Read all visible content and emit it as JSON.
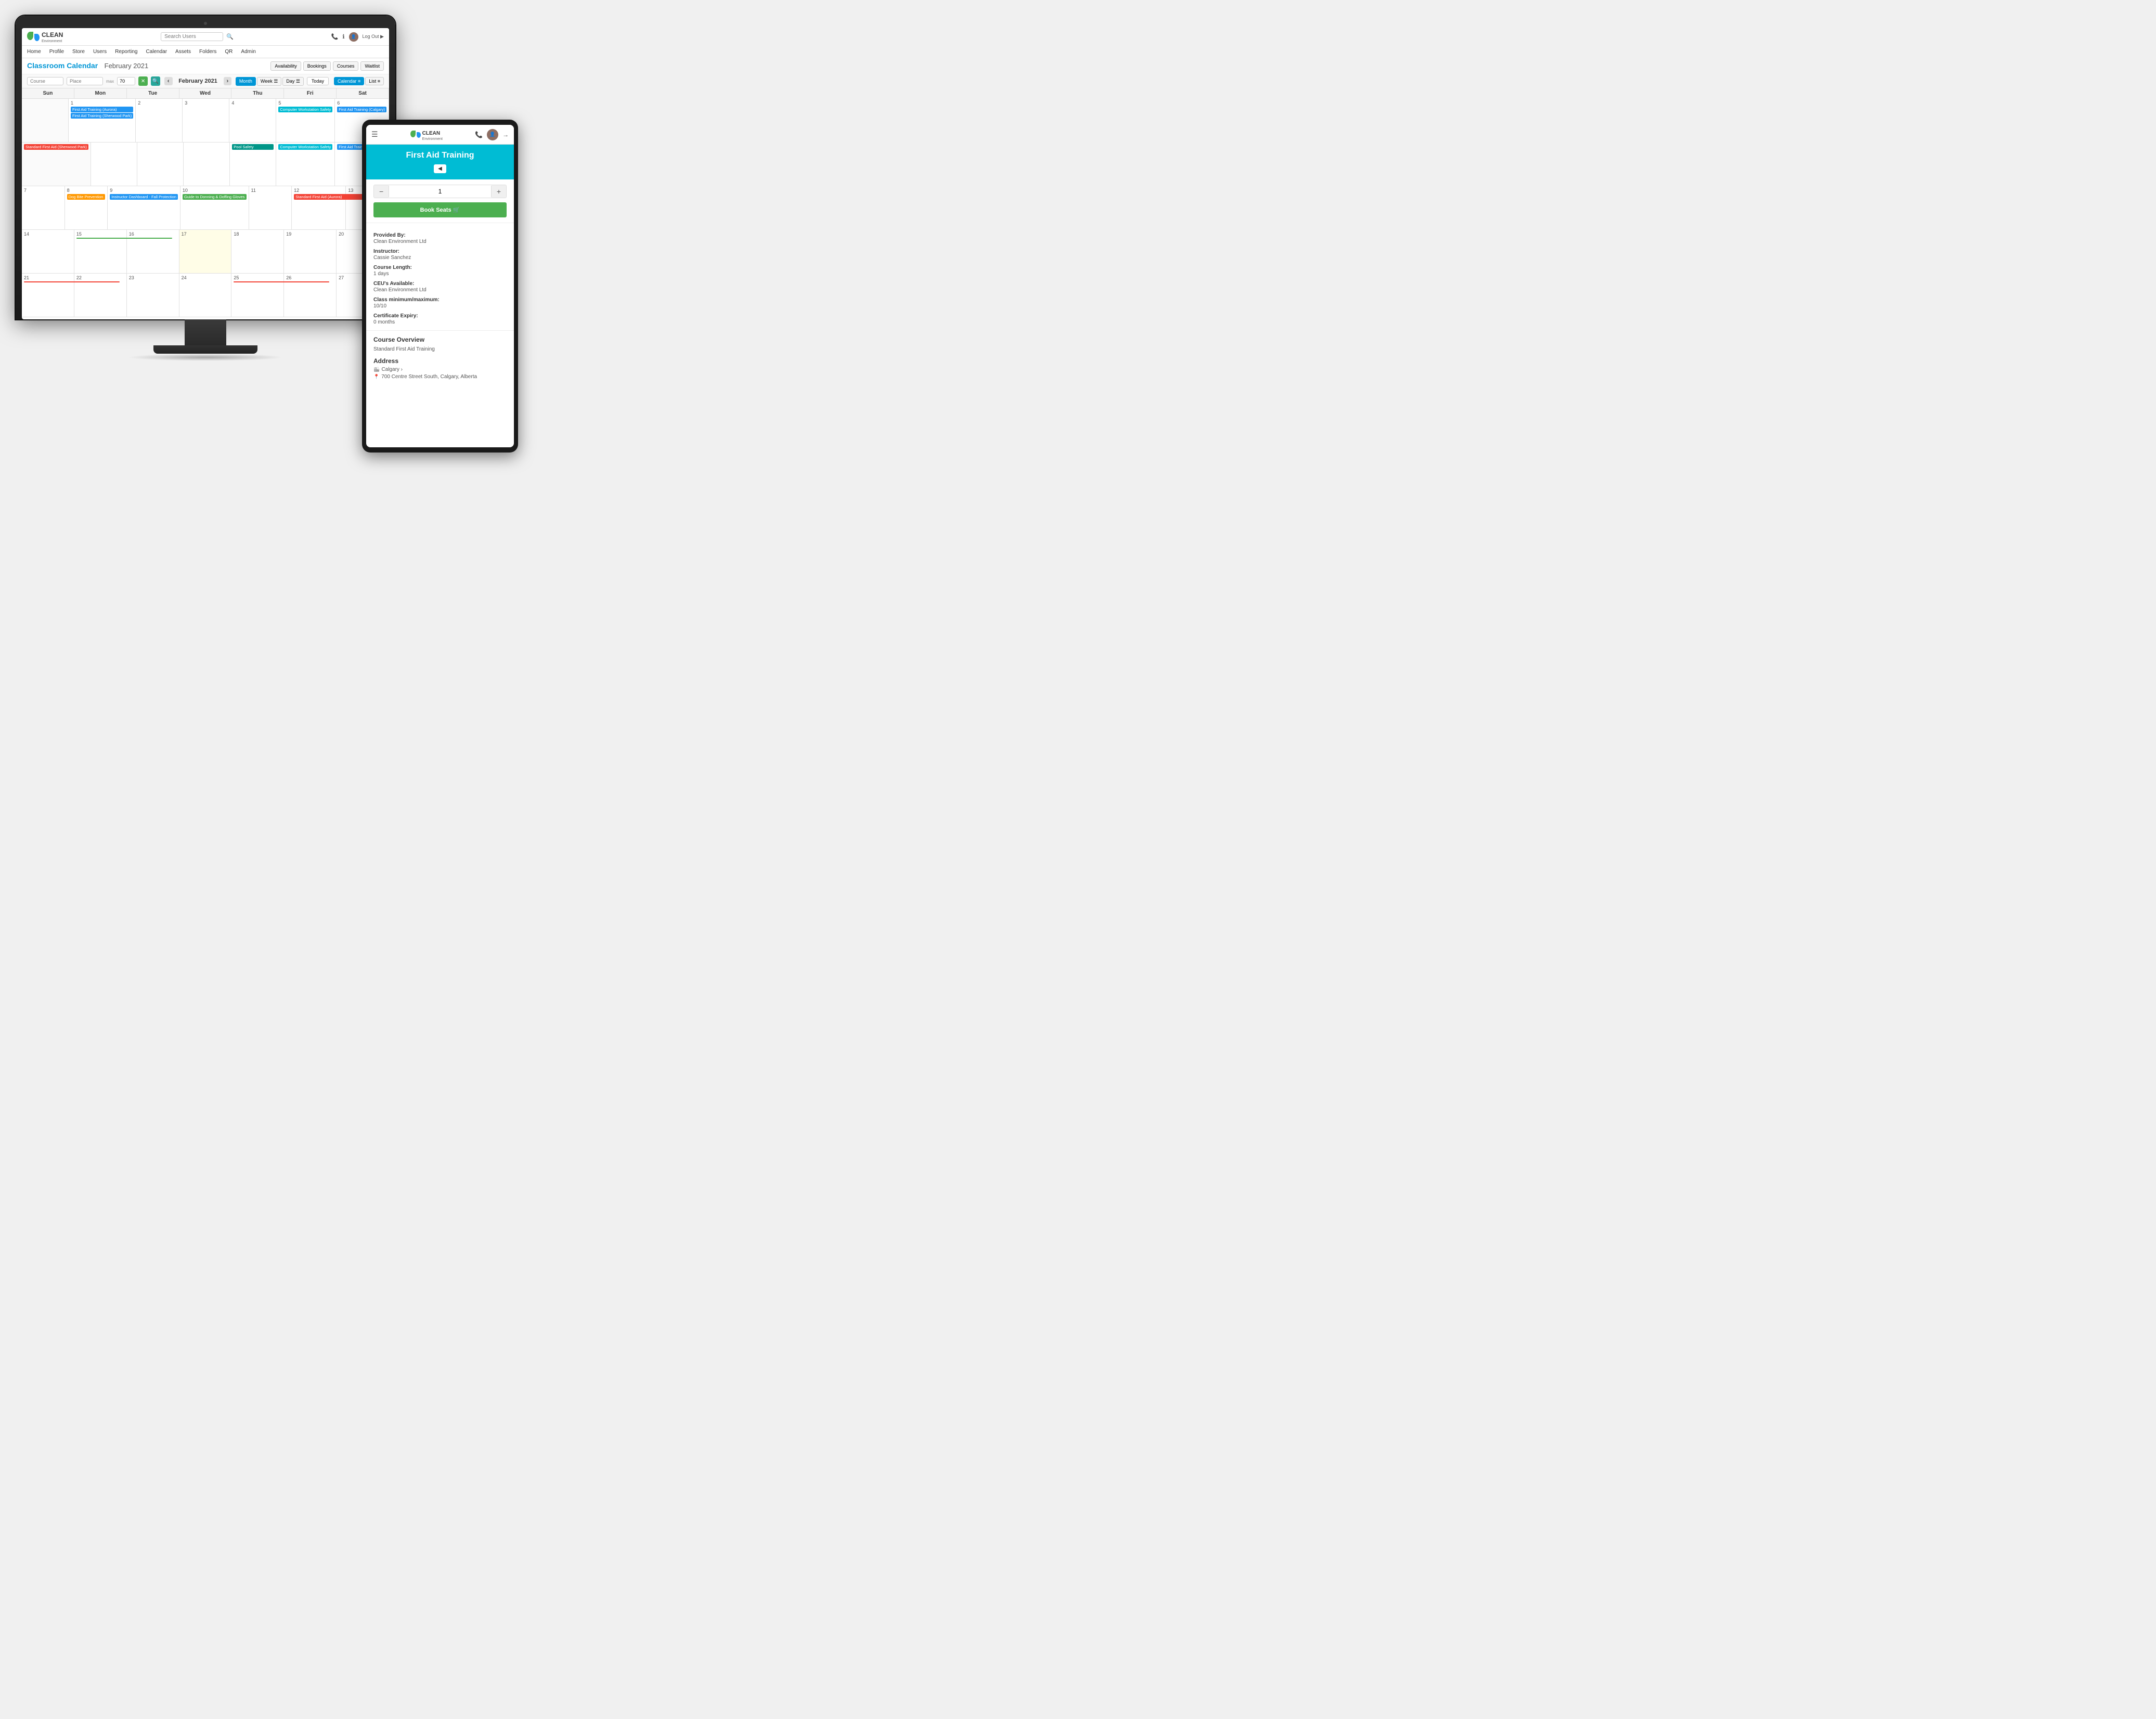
{
  "app": {
    "logo_name": "CLEAN",
    "logo_sub": "Environment",
    "search_placeholder": "Search Users"
  },
  "nav": {
    "items": [
      "Home",
      "Profile",
      "Store",
      "Users",
      "Reporting",
      "Calendar",
      "Assets",
      "Folders",
      "QR",
      "Admin"
    ]
  },
  "calendar": {
    "page_title": "Classroom Calendar",
    "month_label": "February 2021",
    "nav_month": "February 2021",
    "max_label": "max",
    "max_value": "70",
    "course_placeholder": "Course",
    "place_placeholder": "Place",
    "today_label": "Today",
    "calendar_btn": "Calendar ≡",
    "list_btn": "List ≡",
    "month_btn": "Month",
    "week_btn": "Week ☰",
    "day_btn": "Day ☰",
    "availability_btn": "Availability",
    "bookings_btn": "Bookings",
    "courses_btn": "Courses",
    "waitlist_btn": "Waitlist",
    "days": [
      "Sun",
      "Mon",
      "Tue",
      "Wed",
      "Thu",
      "Fri",
      "Sat"
    ],
    "weeks": [
      {
        "cells": [
          {
            "date": "",
            "other": true,
            "events": []
          },
          {
            "date": "1",
            "events": [
              {
                "label": "First Aid Training (Aurora)",
                "color": "ev-blue"
              },
              {
                "label": "First Aid Training (Sherwood Park)",
                "color": "ev-blue"
              }
            ]
          },
          {
            "date": "2",
            "events": []
          },
          {
            "date": "3",
            "events": []
          },
          {
            "date": "4",
            "events": []
          },
          {
            "date": "5",
            "events": [
              {
                "label": "Computer Workstation Safety",
                "color": "ev-cyan"
              }
            ]
          },
          {
            "date": "6",
            "events": [
              {
                "label": "First Aid Training (Calgary)",
                "color": "ev-blue"
              }
            ]
          }
        ]
      },
      {
        "cells": [
          {
            "date": "",
            "other": true,
            "events": [
              {
                "label": "Standard First Aid (Sherwood Park)",
                "color": "ev-red"
              }
            ]
          },
          {
            "date": "",
            "other": false,
            "events": []
          },
          {
            "date": "",
            "other": false,
            "events": []
          },
          {
            "date": "",
            "other": false,
            "events": []
          },
          {
            "date": "",
            "other": false,
            "events": [
              {
                "label": "Pool Safety",
                "color": "ev-teal"
              }
            ]
          },
          {
            "date": "",
            "other": false,
            "events": [
              {
                "label": "Computer Workstation Safety",
                "color": "ev-cyan"
              }
            ]
          },
          {
            "date": "",
            "other": false,
            "events": [
              {
                "label": "First Aid Training (Calgary)",
                "color": "ev-blue"
              }
            ]
          }
        ]
      },
      {
        "cells": [
          {
            "date": "7",
            "events": []
          },
          {
            "date": "8",
            "events": [
              {
                "label": "Dog Bite Prevention",
                "color": "ev-orange"
              }
            ]
          },
          {
            "date": "9",
            "events": [
              {
                "label": "Instructor Dashboard - Fall Protection",
                "color": "ev-blue"
              }
            ]
          },
          {
            "date": "10",
            "events": [
              {
                "label": "Guide to Donning & Doffing Gloves",
                "color": "ev-green"
              }
            ]
          },
          {
            "date": "11",
            "events": []
          },
          {
            "date": "12",
            "events": [
              {
                "label": "Standard First Aid (Aurora)",
                "color": "ev-red"
              }
            ]
          },
          {
            "date": "13",
            "events": []
          }
        ]
      },
      {
        "cells": [
          {
            "date": "14",
            "events": []
          },
          {
            "date": "15",
            "events": [
              {
                "label": "",
                "color": "ev-green",
                "wide": true
              }
            ]
          },
          {
            "date": "16",
            "events": []
          },
          {
            "date": "17",
            "today": true,
            "events": []
          },
          {
            "date": "18",
            "events": []
          },
          {
            "date": "19",
            "events": []
          },
          {
            "date": "20",
            "events": []
          }
        ]
      },
      {
        "cells": [
          {
            "date": "21",
            "events": [
              {
                "label": "",
                "color": "ev-red",
                "wide": true
              }
            ]
          },
          {
            "date": "22",
            "events": []
          },
          {
            "date": "23",
            "events": []
          },
          {
            "date": "24",
            "events": []
          },
          {
            "date": "25",
            "events": [
              {
                "label": "",
                "color": "ev-red",
                "wide": true
              }
            ]
          },
          {
            "date": "26",
            "events": []
          },
          {
            "date": "27",
            "events": []
          }
        ]
      }
    ]
  },
  "tablet": {
    "course_title": "First Aid Training",
    "back_label": "◀",
    "stepper_value": "1",
    "book_seats_label": "Book Seats 🛒",
    "provided_by_label": "Provided By:",
    "provided_by_value": "Clean Environment Ltd",
    "instructor_label": "Instructor:",
    "instructor_value": "Cassie Sanchez",
    "course_length_label": "Course Length:",
    "course_length_value": "1 days",
    "ceu_label": "CEU's Available:",
    "ceu_value": "Clean Environment Ltd",
    "class_min_max_label": "Class minimum/maximum:",
    "class_min_max_value": "10/10",
    "cert_expiry_label": "Certificate Expiry:",
    "cert_expiry_value": "0 months",
    "overview_title": "Course Overview",
    "overview_text": "Standard First Aid Training",
    "address_title": "Address",
    "address_city": "Calgary ›",
    "address_street": "700 Centre Street South, Calgary, Alberta"
  },
  "logout_label": "Log Out ▶"
}
